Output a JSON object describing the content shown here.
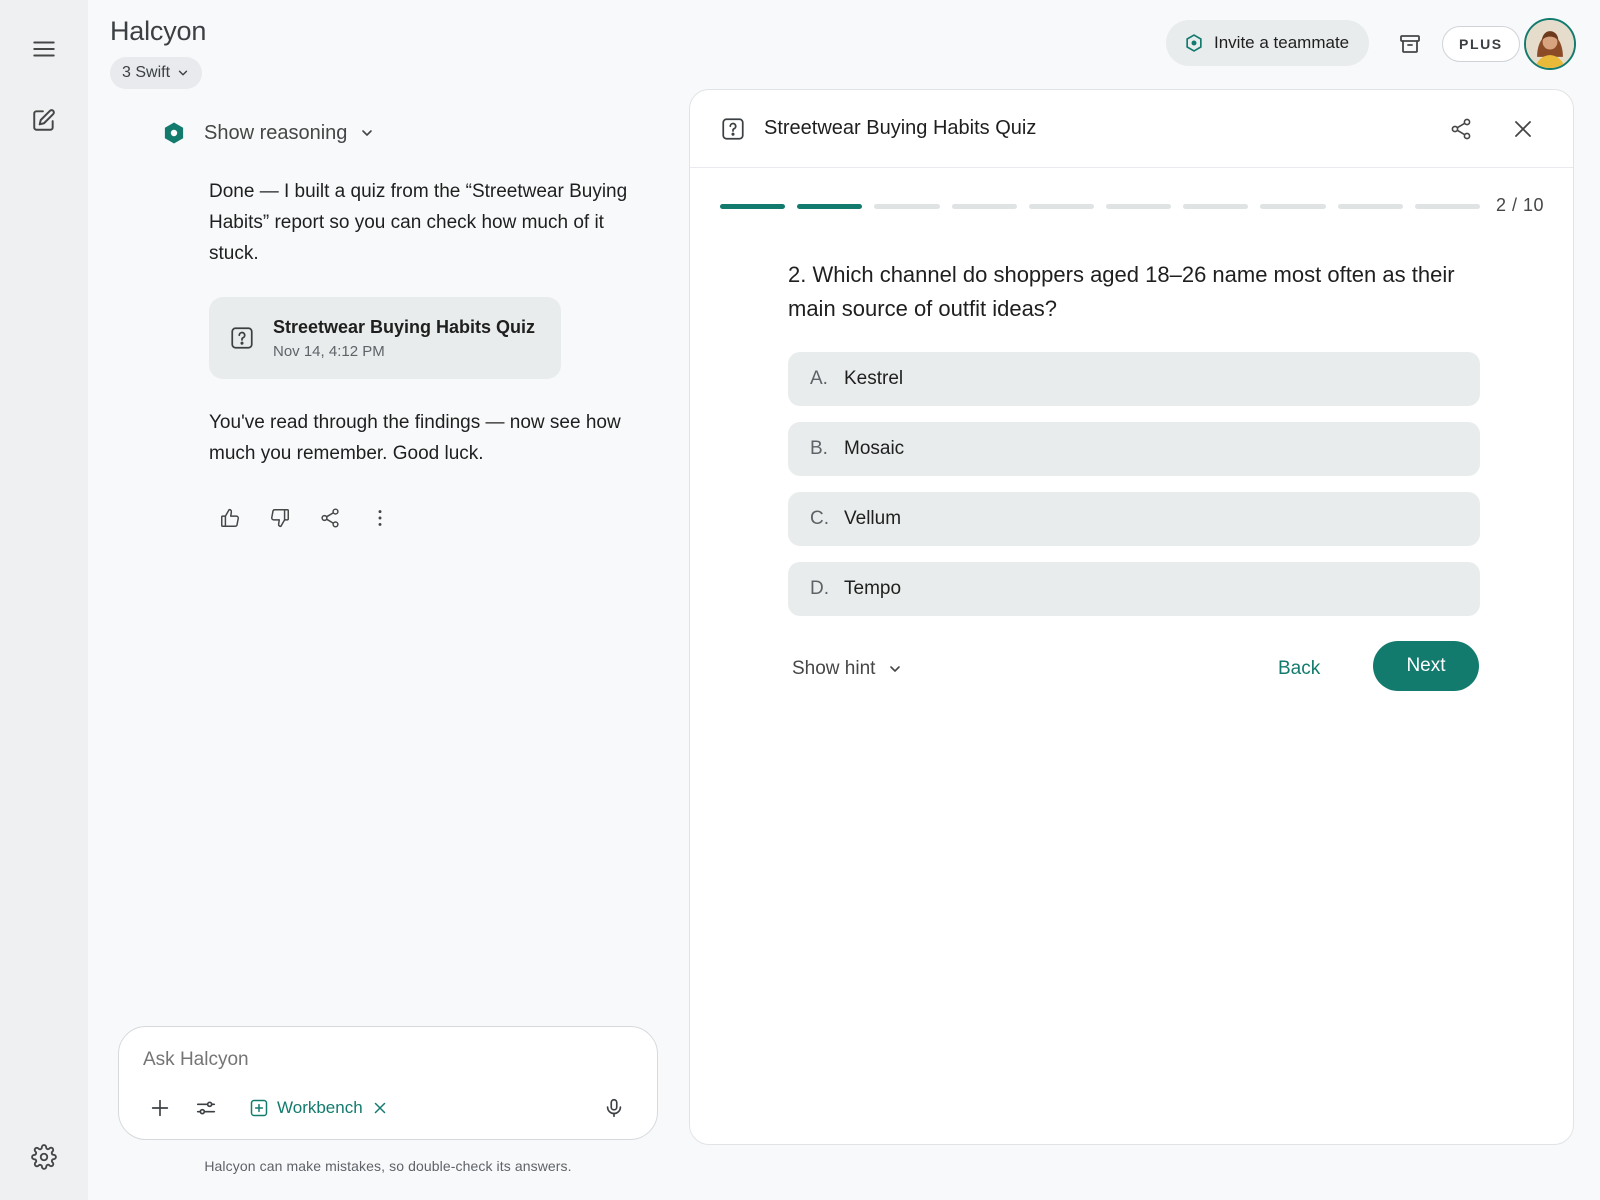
{
  "app": {
    "title": "Halcyon",
    "model": "3 Swift"
  },
  "header": {
    "invite_label": "Invite a teammate",
    "plan_badge": "PLUS"
  },
  "chat": {
    "reasoning_label": "Show reasoning",
    "message_1": "Done — I built a quiz from the “Streetwear Buying Habits” report so you can check how much of it stuck.",
    "artifact": {
      "title": "Streetwear Buying Habits Quiz",
      "timestamp": "Nov 14, 4:12 PM"
    },
    "message_2": "You've read through the findings — now see how much you remember. Good luck."
  },
  "composer": {
    "placeholder": "Ask Halcyon",
    "tool_label": "Workbench",
    "disclaimer": "Halcyon can make mistakes, so double-check its answers."
  },
  "quiz": {
    "title": "Streetwear Buying Habits Quiz",
    "current": 2,
    "total": 10,
    "progress_label": "2 / 10",
    "question": "2. Which channel do shoppers aged 18–26 name most often as their main source of outfit ideas?",
    "options": [
      {
        "letter": "A.",
        "text": "Kestrel"
      },
      {
        "letter": "B.",
        "text": "Mosaic"
      },
      {
        "letter": "C.",
        "text": "Vellum"
      },
      {
        "letter": "D.",
        "text": "Tempo"
      }
    ],
    "hint_label": "Show hint",
    "back_label": "Back",
    "next_label": "Next"
  },
  "colors": {
    "accent": "#137b6e",
    "rail_bg": "#eef0f2",
    "chip_bg": "#e9ecec",
    "page_bg": "#f8f9fa"
  },
  "icons": {
    "rail": [
      "menu-icon",
      "new-chat-icon",
      "settings-icon"
    ],
    "header": [
      "invite-icon",
      "archive-icon",
      "avatar"
    ],
    "message_actions": [
      "thumbs-up-icon",
      "thumbs-down-icon",
      "share-icon",
      "more-icon"
    ],
    "composer": [
      "plus-icon",
      "tools-icon",
      "workbench-icon",
      "close-icon",
      "mic-icon"
    ]
  }
}
